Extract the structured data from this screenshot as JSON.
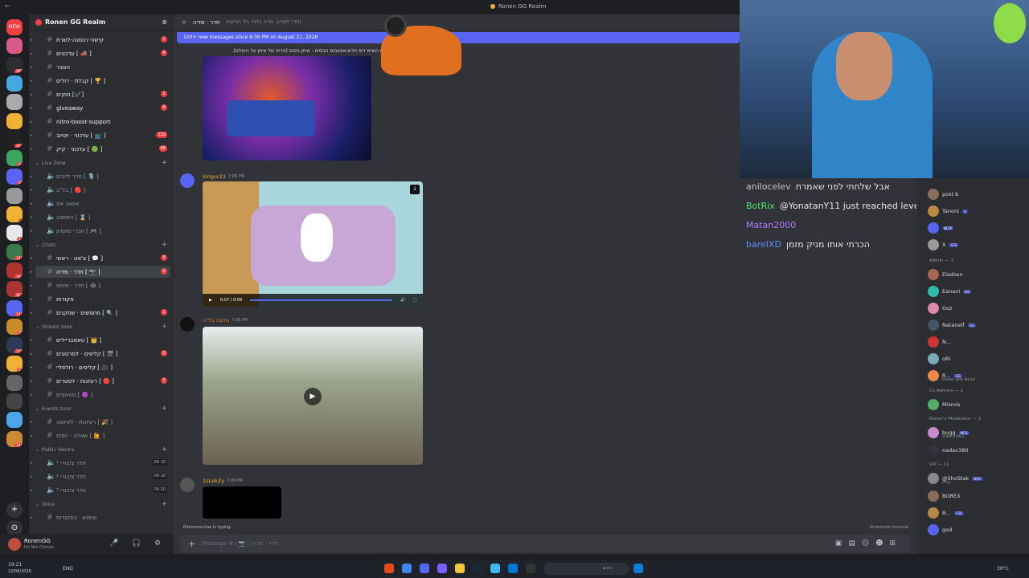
{
  "window": {
    "title": "Ronen GG Realm"
  },
  "server": {
    "name": "Ronen GG Realm"
  },
  "rail": [
    {
      "label": "NEW",
      "badge": ""
    },
    {
      "label": "",
      "badge": "12"
    },
    {
      "label": "",
      "badge": "609"
    },
    {
      "label": "",
      "badge": ""
    },
    {
      "label": "",
      "badge": ""
    },
    {
      "label": "",
      "badge": ""
    },
    {
      "label": "",
      "badge": "417"
    },
    {
      "label": "",
      "badge": "43"
    },
    {
      "label": "",
      "badge": "18"
    },
    {
      "label": "",
      "badge": ""
    },
    {
      "label": "",
      "badge": "3"
    },
    {
      "label": "",
      "badge": "34"
    },
    {
      "label": "",
      "badge": "159"
    },
    {
      "label": "",
      "badge": "192"
    },
    {
      "label": "",
      "badge": "813"
    },
    {
      "label": "",
      "badge": "121"
    },
    {
      "label": "",
      "badge": "75"
    },
    {
      "label": "",
      "badge": "219"
    },
    {
      "label": "",
      "badge": "55"
    },
    {
      "label": "",
      "badge": ""
    },
    {
      "label": "",
      "badge": ""
    },
    {
      "label": "",
      "badge": ""
    },
    {
      "label": "",
      "badge": "241"
    }
  ],
  "channels": [
    {
      "label": "קישור-הזמנה-לשרת",
      "badge": "1",
      "unread": true
    },
    {
      "label": "[ 📣 ] עדכונים",
      "badge": "4",
      "unread": true
    },
    {
      "label": "הסבר",
      "badge": "",
      "unread": true
    },
    {
      "label": "[ 🏆 ] קבלת · רולים",
      "badge": "",
      "unread": true
    },
    {
      "label": "[✔️] חוקים",
      "badge": "2",
      "unread": true
    },
    {
      "label": "giveaway",
      "badge": "9",
      "unread": true
    },
    {
      "label": "nitro-boost-support",
      "badge": "",
      "unread": true
    },
    {
      "label": "[ 📺 ] עדכוני · יוטיוב",
      "badge": "132",
      "unread": true
    },
    {
      "label": "[ 🟢 ] עדכוני · קיק",
      "badge": "66",
      "unread": true
    }
  ],
  "cat_live": "Live Zone",
  "live": [
    {
      "label": "[ 🎙️ ] חדר לייבים"
    },
    {
      "label": "[ 🔴 ] בל\"ב"
    },
    {
      "label": "אסונג אס"
    },
    {
      "label": "[ ⌛ ] המתנה"
    },
    {
      "label": "[ 🎮 ] חברי מועדון"
    }
  ],
  "cat_chats": "Chats",
  "chats": [
    {
      "label": "[ 💬 ] צ'אט · ראשי",
      "badge": "4",
      "unread": true,
      "sel": false
    },
    {
      "label": "[ 📷 ] חדר · מדיה",
      "badge": "3",
      "unread": true,
      "sel": true
    },
    {
      "label": "[ 😂 ] חדר · מימס",
      "badge": "",
      "unread": false,
      "sel": false
    },
    {
      "label": "פקודות",
      "badge": "",
      "unread": true,
      "sel": false
    },
    {
      "label": "[ 🔍 ] מחפשים · שחקנים",
      "badge": "1",
      "unread": true,
      "sel": false
    }
  ],
  "cat_stream": "Stream zone",
  "stream": [
    {
      "label": "[ 👑 ] טאמבריילים",
      "badge": "",
      "unread": true
    },
    {
      "label": "[ 🎬 ] קליפים · לסרטונים",
      "badge": "2",
      "unread": true
    },
    {
      "label": "[ 🎥 ] קליפים · רולפליי",
      "badge": "",
      "unread": true
    },
    {
      "label": "[ 🔴 ] רעיונות · לסטרים",
      "badge": "1",
      "unread": true
    },
    {
      "label": "[ 🟣 ] סטאפים",
      "badge": "",
      "unread": false
    }
  ],
  "cat_events": "Events zone",
  "events": [
    {
      "label": "[ 🎉 ] רעיונות · לאיוונט"
    },
    {
      "label": "[ 🙋 ] שאלה · יומית"
    }
  ],
  "cat_public": "Public Voice's",
  "publicv": [
    {
      "label": "חדר ציבורי ¹",
      "a": "00",
      "b": "10"
    },
    {
      "label": "חדר ציבורי ²",
      "a": "00",
      "b": "10"
    },
    {
      "label": "חדר ציבורי ³",
      "a": "00",
      "b": "10"
    }
  ],
  "cat_voice": "Voice",
  "voice": [
    {
      "label": "שימוש · בפקודות"
    }
  ],
  "user": {
    "name": "RonenGG",
    "status": "Do Not Disturb"
  },
  "chat": {
    "channel": "חדר · מדיה",
    "topic": "חדר למדיה. מדיה בלבד בלי הודעות!",
    "new_messages": "103+ new messages since 6:36 PM on August 21, 2026",
    "first_caption": "סים הוציא דיס חדש:אוטובוס הגיסים - איתן גיסים (הדיס של איתן על העולם).",
    "m1_name": "kingur23",
    "m1_time": "7:06 PM",
    "video_time": "0:07 / 0:09",
    "m2_name": "נתיבה בל\"ה",
    "m2_time": "7:06 PM",
    "m3_name": "1sLekZy",
    "m3_time": "7:06 PM",
    "typing": "Edenmeuchas is typing...",
    "slowmode": "Slowmode Immune",
    "placeholder": "Message # | 📷 | חדר · מדיה"
  },
  "overlay": [
    {
      "user": "anilocelev",
      "text": "אבל שלחתי לפני שאמרת",
      "color": "#c2c2c2"
    },
    {
      "user": "BotRix",
      "text": "@YonatanY11 just reached level 4!",
      "color": "#4ee36a"
    },
    {
      "user": "Matan2000",
      "text": "",
      "color": "#b07cff"
    },
    {
      "user": "bareIXD",
      "text": "הכרתי אותו מניק מזמן",
      "color": "#5b8cff"
    }
  ],
  "members": {
    "top": [
      {
        "name": "post b",
        "tag": ""
      },
      {
        "name": "Tanoni",
        "tag": "IL"
      },
      {
        "name": "",
        "tag": "NLRP"
      },
      {
        "name": "X",
        "tag": "GTS"
      }
    ],
    "admin_hdr": "Admin — 7",
    "admin": [
      {
        "name": "Eladoxx",
        "tag": ""
      },
      {
        "name": "Eanani",
        "tag": "GG"
      },
      {
        "name": "Goz",
        "tag": ""
      },
      {
        "name": "Natanelf",
        "tag": "GG"
      },
      {
        "name": "N...",
        "tag": ""
      },
      {
        "name": "oRi",
        "tag": ""
      },
      {
        "name": "R...",
        "tag": "GG",
        "sub": "Roblox with Medal"
      }
    ],
    "co_hdr": "Co Admins — 1",
    "co": [
      {
        "name": "Mismis",
        "tag": ""
      }
    ],
    "mod_hdr": "Ronen's Moderator — 2",
    "mod": [
      {
        "name": "bugg",
        "tag": "MCIL",
        "sub": "Video Editor..."
      },
      {
        "name": "nadav380",
        "tag": ""
      }
    ],
    "vip_hdr": "VIP — 11",
    "vip": [
      {
        "name": "@ShoStak",
        "tag": "DISC",
        "sub": "2Key"
      },
      {
        "name": "BOREX",
        "tag": ""
      },
      {
        "name": "B...",
        "tag": "CSIL"
      },
      {
        "name": "god",
        "tag": ""
      }
    ]
  },
  "taskbar": {
    "time": "19:21",
    "date": "22/08/2026",
    "lang": "ENG",
    "search": "חיפוש",
    "weather": "30°C"
  }
}
